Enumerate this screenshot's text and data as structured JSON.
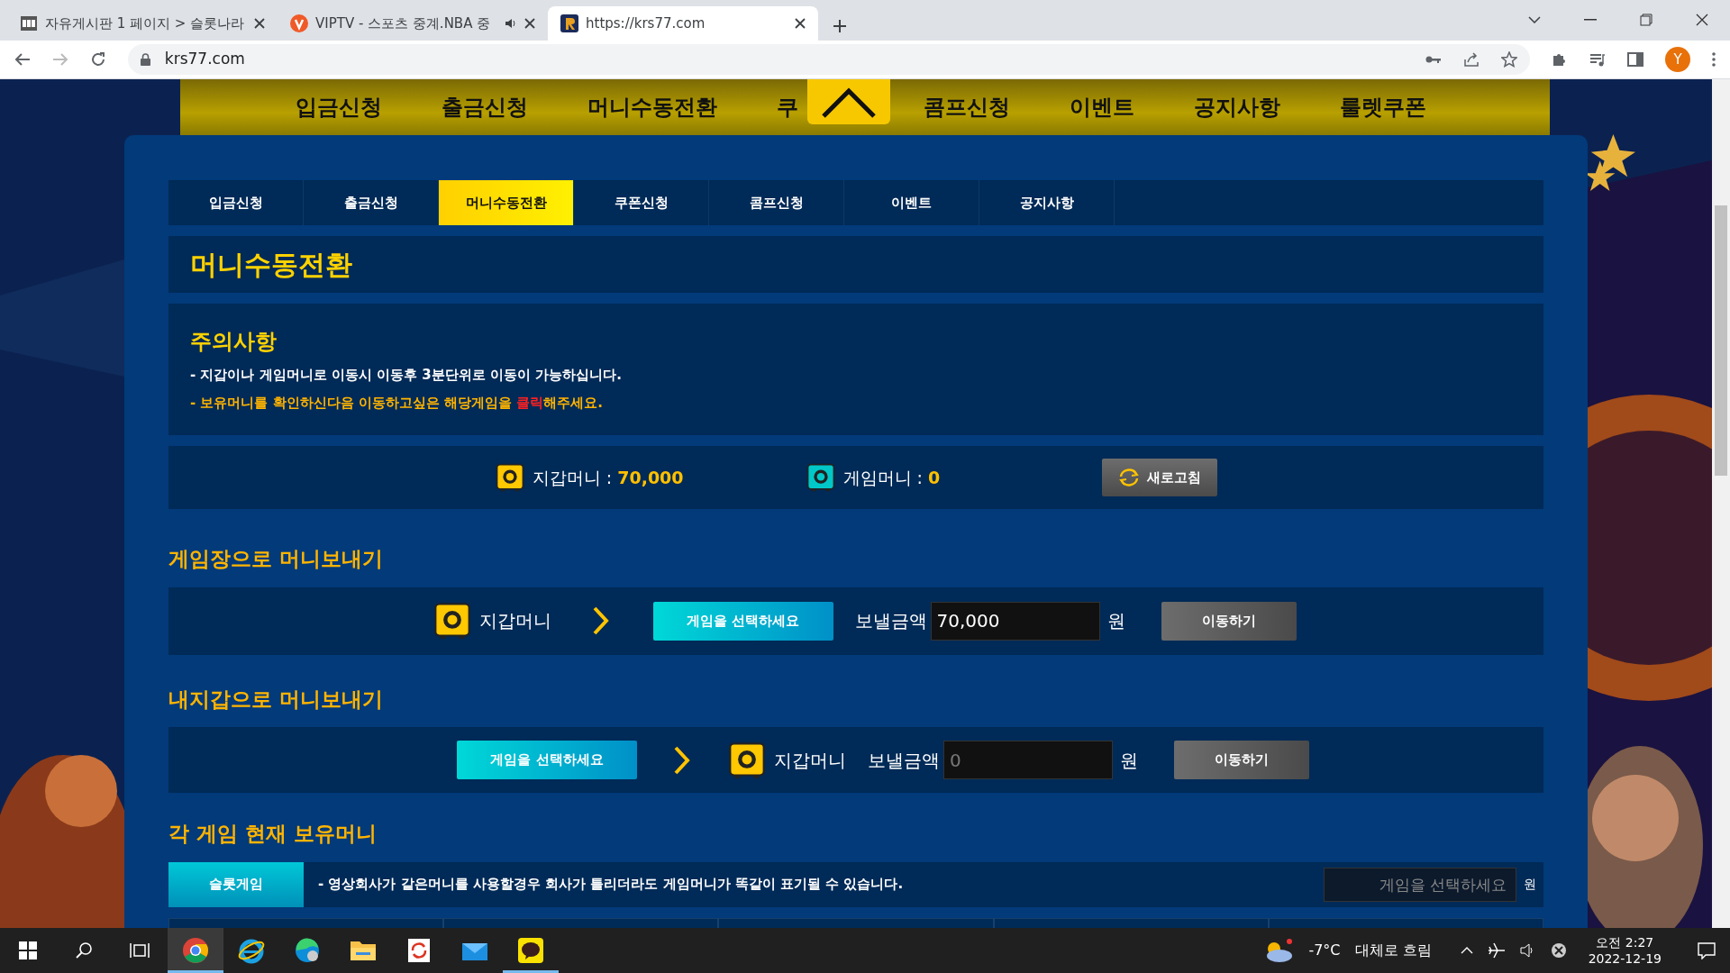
{
  "browser": {
    "tabs": [
      {
        "title": "자유게시판 1 페이지 > 슬롯나라",
        "selected": false,
        "audio": false
      },
      {
        "title": "VIPTV - 스포츠 중계.NBA 중",
        "selected": false,
        "audio": true
      },
      {
        "title": "https://krs77.com",
        "selected": true,
        "audio": false
      }
    ],
    "address": "krs77.com",
    "profile_initial": "Y"
  },
  "site_nav": {
    "items": [
      "입금신청",
      "출금신청",
      "머니수동전환",
      "쿠",
      "콤프신청",
      "이벤트",
      "공지사항",
      "룰렛쿠폰"
    ]
  },
  "tabs": [
    {
      "label": "입금신청",
      "selected": false
    },
    {
      "label": "출금신청",
      "selected": false
    },
    {
      "label": "머니수동전환",
      "selected": true
    },
    {
      "label": "쿠폰신청",
      "selected": false
    },
    {
      "label": "콤프신청",
      "selected": false
    },
    {
      "label": "이벤트",
      "selected": false
    },
    {
      "label": "공지사항",
      "selected": false
    }
  ],
  "page_title": "머니수동전환",
  "notice": {
    "title": "주의사항",
    "lines": [
      {
        "kind": "plain",
        "parts": [
          {
            "text": "- 지갑이나 게임머니로 이동시 이동후 3분단위로 이동이 가능하십니다.",
            "kind": "normal"
          }
        ]
      },
      {
        "kind": "highlight",
        "parts": [
          {
            "text": "- 보유머니를 확인하신다음 이동하고싶은 해당게임을 ",
            "kind": "normal"
          },
          {
            "text": "클릭",
            "kind": "alert"
          },
          {
            "text": "해주세요.",
            "kind": "normal"
          }
        ]
      }
    ]
  },
  "balance": {
    "wallet_label": "지갑머니 : ",
    "wallet_value": "70,000",
    "game_label": "게임머니 : ",
    "game_value": "0",
    "refresh": "새로고침"
  },
  "transfers": [
    {
      "kind": "to_game",
      "heading": "게임장으로 머니보내기",
      "wallet_label": "지갑머니",
      "game_button": "게임을 선택하세요",
      "amount_label": "보낼금액",
      "amount_value": "70,000",
      "unit": "원",
      "submit": "이동하기"
    },
    {
      "kind": "to_wallet",
      "heading": "내지갑으로 머니보내기",
      "wallet_label": "지갑머니",
      "game_button": "게임을 선택하세요",
      "amount_label": "보낼금액",
      "amount_placeholder": "0",
      "unit": "원",
      "submit": "이동하기"
    }
  ],
  "holdings": {
    "heading": "각 게임 현재 보유머니",
    "tab": "슬롯게임",
    "note": "- 영상회사가 같은머니를 사용할경우 회사가 틀리더라도 게임머니가 똑같이 표기될 수 있습니다.",
    "select_placeholder": "게임을 선택하세요",
    "unit": "원"
  },
  "taskbar": {
    "apps": [
      {
        "selected": true,
        "running": true
      },
      {
        "selected": false,
        "running": false
      },
      {
        "selected": false,
        "running": false
      },
      {
        "selected": false,
        "running": false
      },
      {
        "selected": false,
        "running": false
      },
      {
        "selected": false,
        "running": false
      },
      {
        "selected": false,
        "running": true
      }
    ],
    "temperature": "-7°C",
    "weather": "대체로 흐림",
    "time": "오전 2:27",
    "date": "2022-12-19"
  }
}
